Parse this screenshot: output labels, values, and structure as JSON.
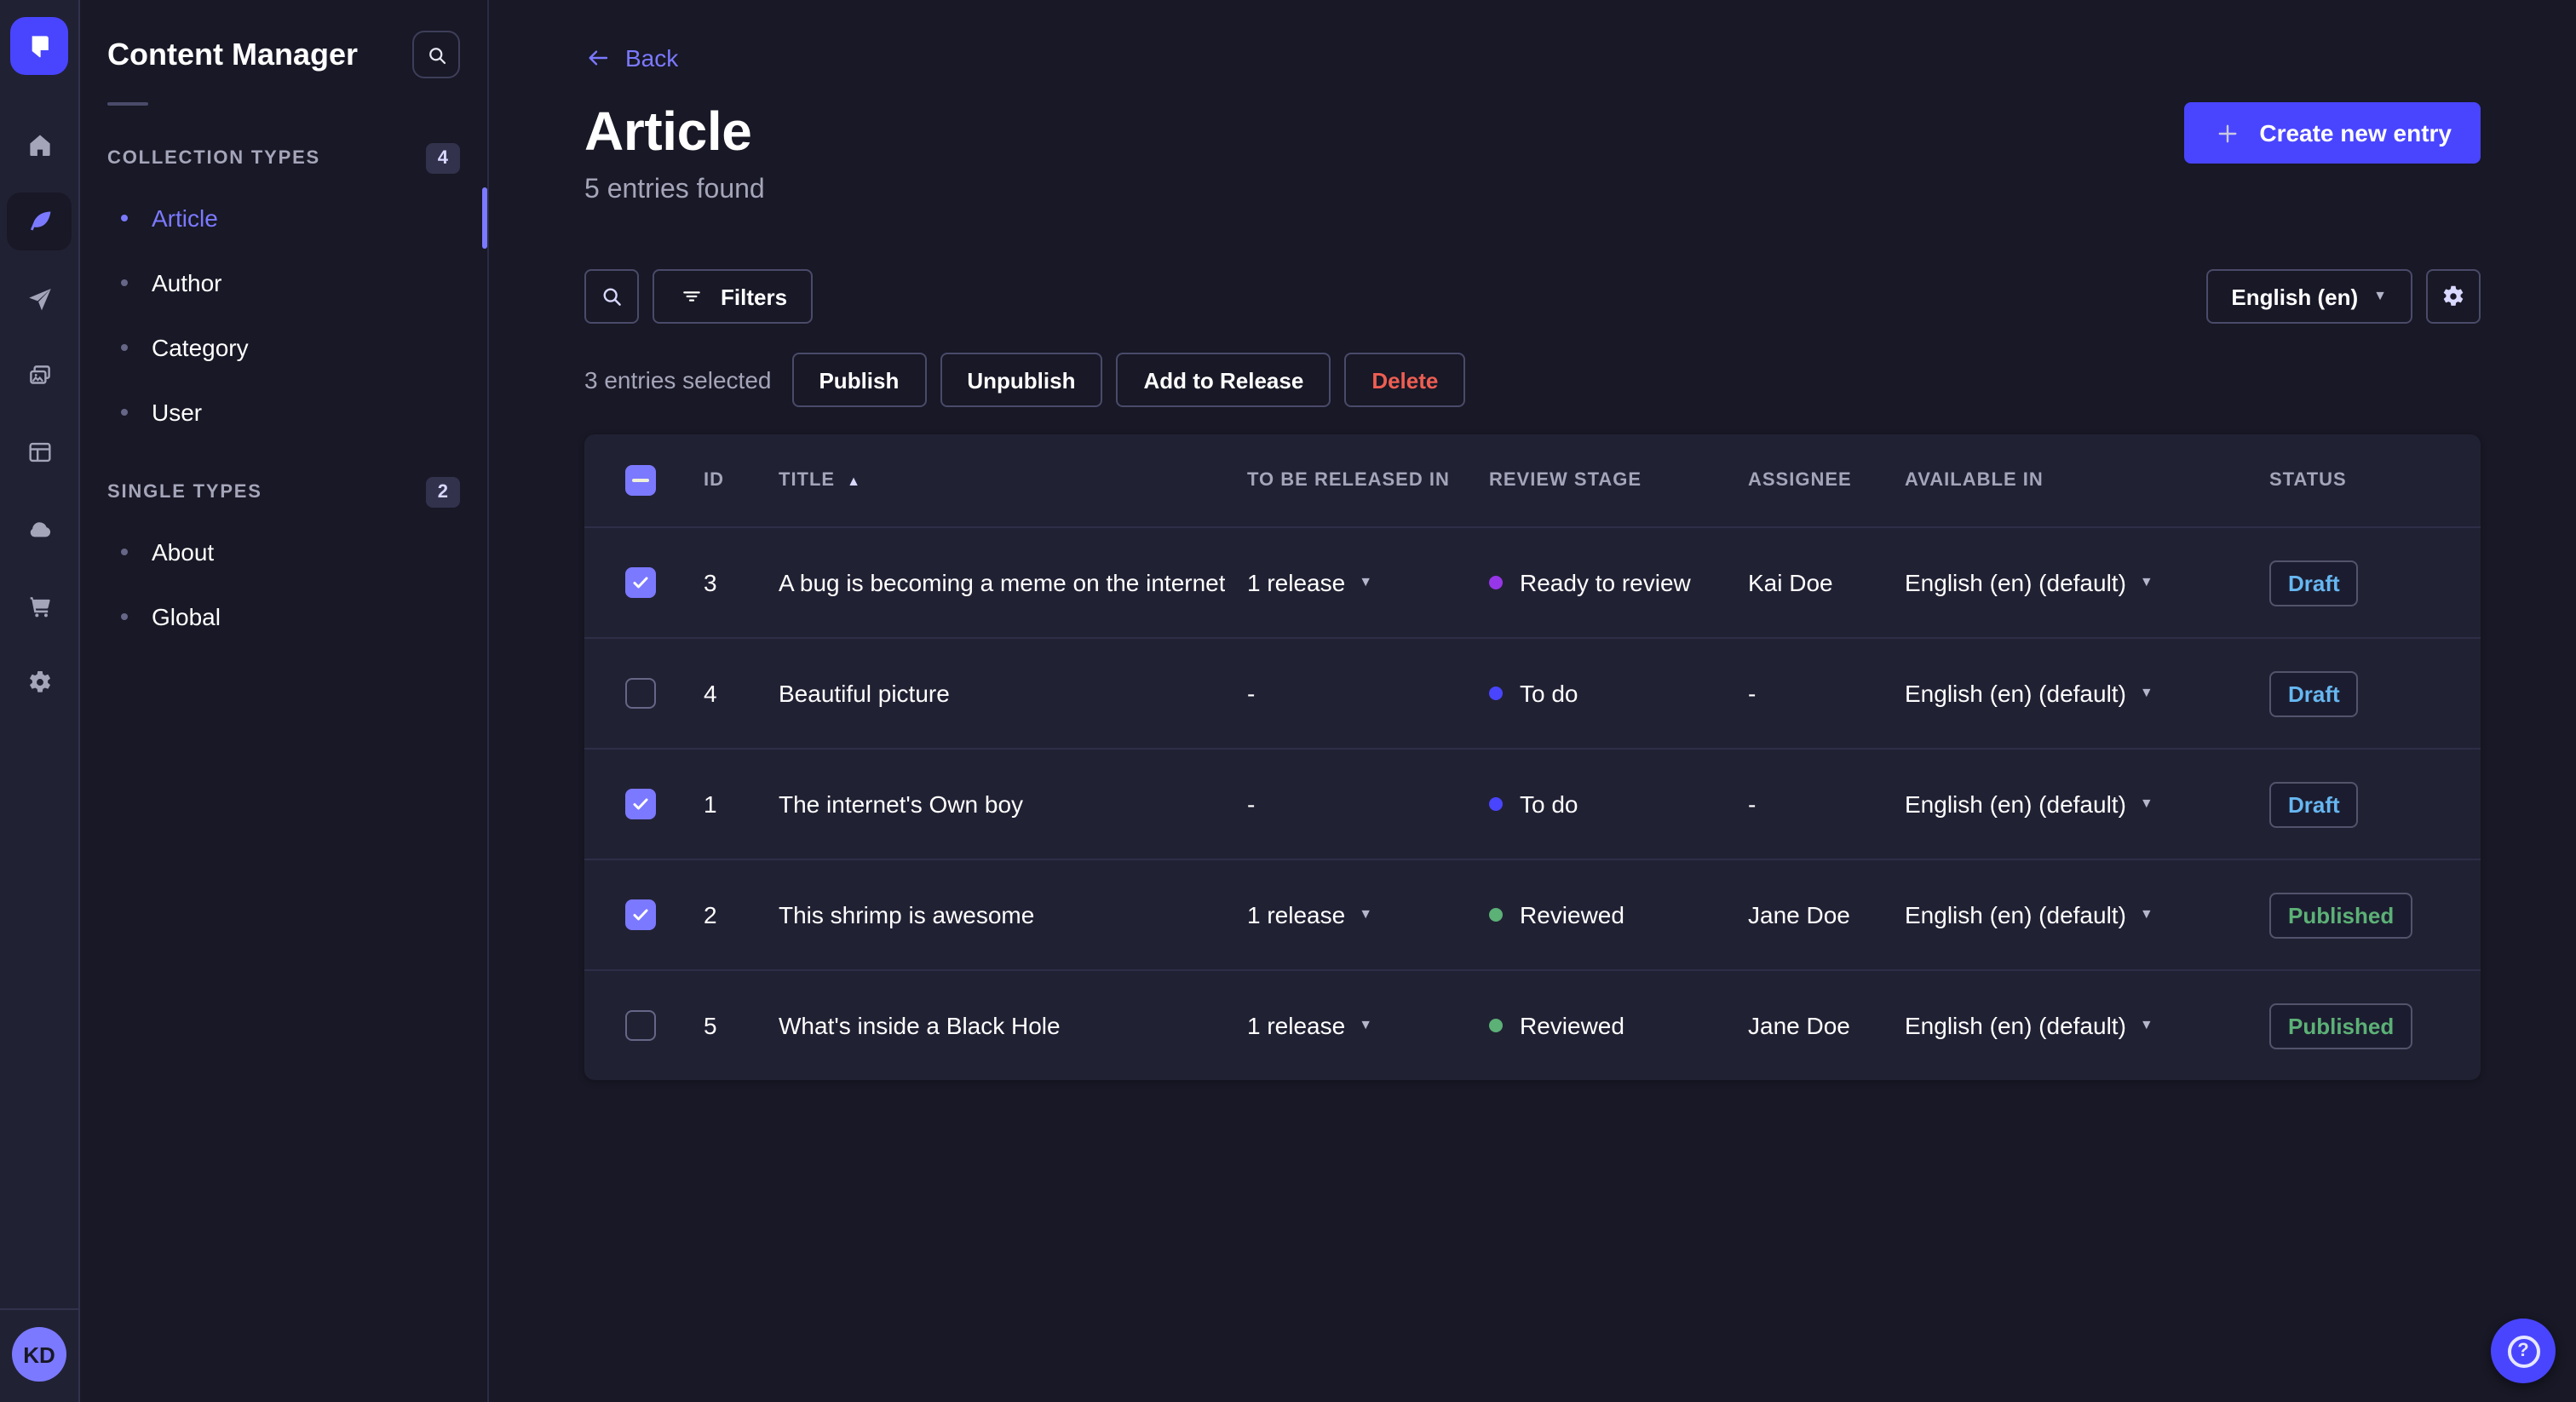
{
  "colors": {
    "accent": "#4945ff",
    "accent_light": "#7b79ff",
    "draft": "#66b7f1",
    "published": "#5cb176",
    "danger": "#ee5e52",
    "stage_todo": "#4945ff",
    "stage_ready_to_review": "#9736e8",
    "stage_reviewed": "#5cb176"
  },
  "rail": {
    "icons": [
      {
        "name": "home"
      },
      {
        "name": "content-manager",
        "active": true
      },
      {
        "name": "releases"
      },
      {
        "name": "media-library"
      },
      {
        "name": "content-type-builder"
      },
      {
        "name": "deploy"
      },
      {
        "name": "marketplace"
      },
      {
        "name": "settings"
      }
    ],
    "avatar_initials": "KD"
  },
  "subnav": {
    "title": "Content Manager",
    "sections": [
      {
        "label": "COLLECTION TYPES",
        "badge": "4",
        "items": [
          {
            "label": "Article",
            "active": true
          },
          {
            "label": "Author"
          },
          {
            "label": "Category"
          },
          {
            "label": "User"
          }
        ]
      },
      {
        "label": "SINGLE TYPES",
        "badge": "2",
        "items": [
          {
            "label": "About"
          },
          {
            "label": "Global"
          }
        ]
      }
    ]
  },
  "header": {
    "back_label": "Back",
    "title": "Article",
    "subtitle": "5 entries found",
    "create_label": "Create new entry"
  },
  "toolbar": {
    "filters_label": "Filters",
    "locale_label": "English (en)"
  },
  "selection": {
    "label": "3 entries selected",
    "actions": [
      {
        "label": "Publish"
      },
      {
        "label": "Unpublish"
      },
      {
        "label": "Add to Release"
      },
      {
        "label": "Delete",
        "danger": true
      }
    ]
  },
  "table": {
    "select_all_state": "indeterminate",
    "headers": [
      "ID",
      "TITLE",
      "TO BE RELEASED IN",
      "REVIEW STAGE",
      "ASSIGNEE",
      "AVAILABLE IN",
      "STATUS"
    ],
    "sort": {
      "column": "TITLE",
      "direction": "asc"
    },
    "rows": [
      {
        "checked": true,
        "id": "3",
        "title": "A bug is becoming a meme on the internet",
        "release": "1 release",
        "stage": "Ready to review",
        "stage_color": "#9736e8",
        "assignee": "Kai Doe",
        "locale": "English (en) (default)",
        "status": "Draft",
        "status_color": "#66b7f1"
      },
      {
        "checked": false,
        "id": "4",
        "title": "Beautiful picture",
        "release": "-",
        "stage": "To do",
        "stage_color": "#4945ff",
        "assignee": "-",
        "locale": "English (en) (default)",
        "status": "Draft",
        "status_color": "#66b7f1"
      },
      {
        "checked": true,
        "id": "1",
        "title": "The internet's Own boy",
        "release": "-",
        "stage": "To do",
        "stage_color": "#4945ff",
        "assignee": "-",
        "locale": "English (en) (default)",
        "status": "Draft",
        "status_color": "#66b7f1"
      },
      {
        "checked": true,
        "id": "2",
        "title": "This shrimp is awesome",
        "release": "1 release",
        "stage": "Reviewed",
        "stage_color": "#5cb176",
        "assignee": "Jane Doe",
        "locale": "English (en) (default)",
        "status": "Published",
        "status_color": "#5cb176"
      },
      {
        "checked": false,
        "id": "5",
        "title": "What's inside a Black Hole",
        "release": "1 release",
        "stage": "Reviewed",
        "stage_color": "#5cb176",
        "assignee": "Jane Doe",
        "locale": "English (en) (default)",
        "status": "Published",
        "status_color": "#5cb176"
      }
    ]
  },
  "help": {
    "icon": "?"
  }
}
